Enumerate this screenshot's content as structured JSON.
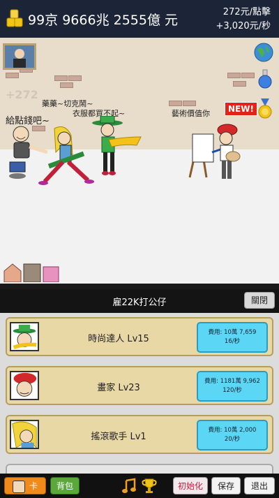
{
  "header": {
    "money": "99京 9666兆 2555億 元",
    "per_click": "272元/點擊",
    "per_second": "+3,020元/秒"
  },
  "scene": {
    "float_text": "+272",
    "speech_beggar": "給點錢吧~",
    "speech_rocker": "藥藥~切克鬧~",
    "speech_fashion": "衣服都買不起~",
    "speech_painter": "藝術價值你",
    "new_badge": "NEW!"
  },
  "panel": {
    "title": "雇22K打公仔",
    "close_label": "關閉",
    "cards": [
      {
        "name": "時尚達人 Lv15",
        "cost": "費用: 10萬 7,659",
        "rate": "16/秒"
      },
      {
        "name": "畫家 Lv23",
        "cost": "費用: 1181萬 9,962",
        "rate": "120/秒"
      },
      {
        "name": "搖滾歌手 Lv1",
        "cost": "費用: 10萬 2,000",
        "rate": "20/秒"
      }
    ]
  },
  "bottom": {
    "card_label": "卡",
    "backpack_label": "背包",
    "init_label": "初始化",
    "save_label": "保存",
    "exit_label": "退出"
  },
  "colors": {
    "topbar": "#1c2438",
    "wall": "#e8dccb",
    "card": "#e8d8a6",
    "buy_button": "#5bd7f5",
    "new_badge": "#e2231a"
  }
}
